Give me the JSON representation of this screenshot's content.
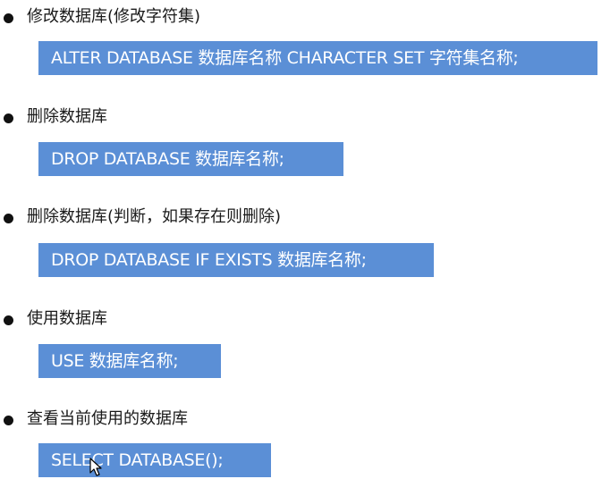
{
  "items": [
    {
      "heading": "修改数据库(修改字符集)",
      "code": "ALTER DATABASE 数据库名称 CHARACTER SET 字符集名称;"
    },
    {
      "heading": "删除数据库",
      "code": "DROP DATABASE 数据库名称;"
    },
    {
      "heading": "删除数据库(判断，如果存在则删除)",
      "code": "DROP DATABASE IF EXISTS 数据库名称;"
    },
    {
      "heading": "使用数据库",
      "code": "USE 数据库名称;"
    },
    {
      "heading": "查看当前使用的数据库",
      "code": "SELECT DATABASE();"
    }
  ],
  "colors": {
    "code_box_bg": "#5b8fd6",
    "code_text": "#ffffff",
    "heading_text": "#1a1a1a"
  },
  "icons": {
    "bullet": "bullet-dot-icon",
    "cursor": "mouse-pointer-icon"
  }
}
